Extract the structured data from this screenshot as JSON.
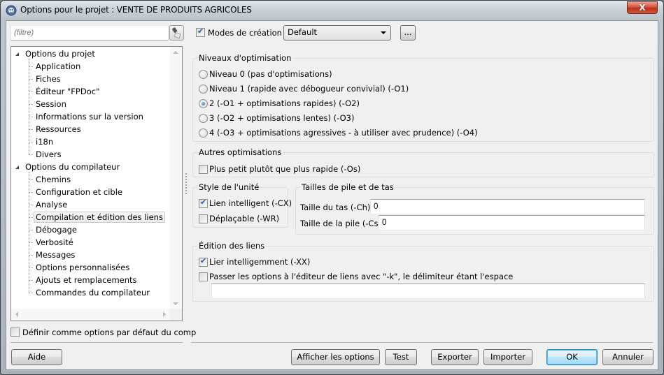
{
  "window": {
    "title": "Options pour le projet : VENTE DE PRODUITS AGRICOLES",
    "close_label": "X",
    "app_icon": "lazarus-cheetah-icon"
  },
  "left_panel": {
    "filter": {
      "value": "",
      "placeholder": "(filtre)"
    },
    "filter_clear_icon": "broom-icon",
    "tree": [
      {
        "label": "Options du projet",
        "level": 0,
        "expanded": true
      },
      {
        "label": "Application",
        "level": 1
      },
      {
        "label": "Fiches",
        "level": 1
      },
      {
        "label": "Éditeur \"FPDoc\"",
        "level": 1
      },
      {
        "label": "Session",
        "level": 1
      },
      {
        "label": "Informations sur la version",
        "level": 1
      },
      {
        "label": "Ressources",
        "level": 1
      },
      {
        "label": "i18n",
        "level": 1
      },
      {
        "label": "Divers",
        "level": 1
      },
      {
        "label": "Options du compilateur",
        "level": 0,
        "expanded": true
      },
      {
        "label": "Chemins",
        "level": 1
      },
      {
        "label": "Configuration et cible",
        "level": 1
      },
      {
        "label": "Analyse",
        "level": 1
      },
      {
        "label": "Compilation et édition des liens",
        "level": 1,
        "selected": true
      },
      {
        "label": "Débogage",
        "level": 1
      },
      {
        "label": "Verbosité",
        "level": 1
      },
      {
        "label": "Messages",
        "level": 1
      },
      {
        "label": "Options personnalisées",
        "level": 1
      },
      {
        "label": "Ajouts et remplacements",
        "level": 1
      },
      {
        "label": "Commandes du compilateur",
        "level": 1
      }
    ],
    "default_options": {
      "label": "Définir comme options par défaut du comp",
      "checked": false
    }
  },
  "build_modes": {
    "checkbox_label": "Modes de création",
    "checked": true,
    "selected": "Default",
    "ellipsis_label": "..."
  },
  "optimization_levels": {
    "title": "Niveaux d'optimisation",
    "options": [
      {
        "label": "Niveau 0 (pas d'optimisations)",
        "checked": false
      },
      {
        "label": "Niveau 1 (rapide avec débogueur convivial) (-O1)",
        "checked": false
      },
      {
        "label": "2 (-O1 + optimisations rapides) (-O2)",
        "checked": true
      },
      {
        "label": "3 (-O2 + optimisations lentes) (-O3)",
        "checked": false
      },
      {
        "label": "4 (-O3 + optimisations agressives - à utiliser avec prudence) (-O4)",
        "checked": false
      }
    ]
  },
  "other_optimizations": {
    "title": "Autres optimisations",
    "smaller": {
      "label": "Plus petit plutôt que plus rapide (-Os)",
      "checked": false
    }
  },
  "unit_style": {
    "title": "Style de l'unité",
    "smart_link": {
      "label": "Lien intelligent (-CX)",
      "checked": true
    },
    "relocatable": {
      "label": "Déplaçable (-WR)",
      "checked": false
    }
  },
  "stack_heap": {
    "title": "Tailles de pile et de tas",
    "heap": {
      "label": "Taille du tas (-Ch)",
      "value": "0"
    },
    "stack": {
      "label": "Taille de la pile (-Cs)",
      "value": "0"
    }
  },
  "linking": {
    "title": "Édition des liens",
    "smart_link": {
      "label": "Lier intelligemment (-XX)",
      "checked": true
    },
    "pass_options": {
      "label": "Passer les options à l'éditeur de liens avec \"-k\", le délimiteur étant l'espace",
      "checked": false
    },
    "options_value": ""
  },
  "buttons": {
    "help": "Aide",
    "show_options": "Afficher les options",
    "test": "Test",
    "export": "Exporter",
    "import": "Importer",
    "ok": "OK",
    "cancel": "Annuler"
  }
}
